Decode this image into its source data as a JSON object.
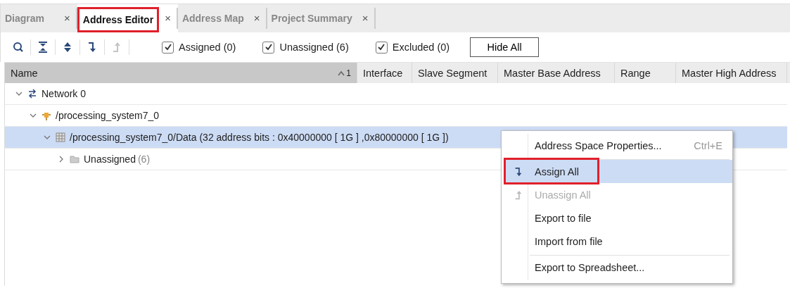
{
  "tabs": [
    {
      "label": "Diagram",
      "selected": false,
      "highlighted": false,
      "close": "×"
    },
    {
      "label": "Address Editor",
      "selected": true,
      "highlighted": true,
      "close": "×"
    },
    {
      "label": "Address Map",
      "selected": false,
      "highlighted": false,
      "close": "×"
    },
    {
      "label": "Project Summary",
      "selected": false,
      "highlighted": false,
      "close": "×"
    }
  ],
  "toolbar": {
    "tools": [
      {
        "kind": "search",
        "disabled": false
      },
      {
        "kind": "collapse",
        "disabled": false
      },
      {
        "kind": "expand",
        "disabled": false
      },
      {
        "kind": "assign",
        "disabled": false
      },
      {
        "kind": "unassign",
        "disabled": true
      }
    ],
    "filters": [
      {
        "label": "Assigned (0)",
        "checked": true
      },
      {
        "label": "Unassigned (6)",
        "checked": true
      },
      {
        "label": "Excluded (0)",
        "checked": true
      }
    ],
    "button": "Hide All"
  },
  "table": {
    "columns": [
      {
        "label": "Name",
        "sorted": true,
        "sort_index": "1"
      },
      {
        "label": "Interface",
        "sorted": false
      },
      {
        "label": "Slave Segment",
        "sorted": false
      },
      {
        "label": "Master Base Address",
        "sorted": false
      },
      {
        "label": "Range",
        "sorted": false
      },
      {
        "label": "Master High Address",
        "sorted": false
      }
    ],
    "tree": [
      {
        "label": "Network 0",
        "kind": "network",
        "expanded": true,
        "selected": false,
        "children": [
          {
            "label": "/processing_system7_0",
            "kind": "chip",
            "expanded": true,
            "selected": false,
            "children": [
              {
                "label": "/processing_system7_0/Data (32 address bits : 0x40000000 [ 1G ] ,0x80000000 [ 1G ])",
                "kind": "grid",
                "expanded": true,
                "selected": true,
                "children": [
                  {
                    "label": "Unassigned",
                    "count": "(6)",
                    "kind": "folder",
                    "expanded": false,
                    "selected": false
                  }
                ]
              }
            ]
          }
        ]
      }
    ]
  },
  "context_menu": [
    {
      "label": "Address Space Properties...",
      "shortcut": "Ctrl+E",
      "disabled": false,
      "selected": false,
      "highlighted": false,
      "separator_after": true
    },
    {
      "label": "Assign All",
      "kind": "assign",
      "disabled": false,
      "selected": true,
      "highlighted": true,
      "separator_after": false
    },
    {
      "label": "Unassign All",
      "kind": "unassign",
      "disabled": true,
      "selected": false,
      "highlighted": false,
      "separator_after": false
    },
    {
      "label": "Export to file",
      "disabled": false,
      "selected": false,
      "highlighted": false,
      "separator_after": false
    },
    {
      "label": "Import from file",
      "disabled": false,
      "selected": false,
      "highlighted": false,
      "separator_after": true
    },
    {
      "label": "Export to Spreadsheet...",
      "disabled": false,
      "selected": false,
      "highlighted": false,
      "separator_after": false
    }
  ]
}
